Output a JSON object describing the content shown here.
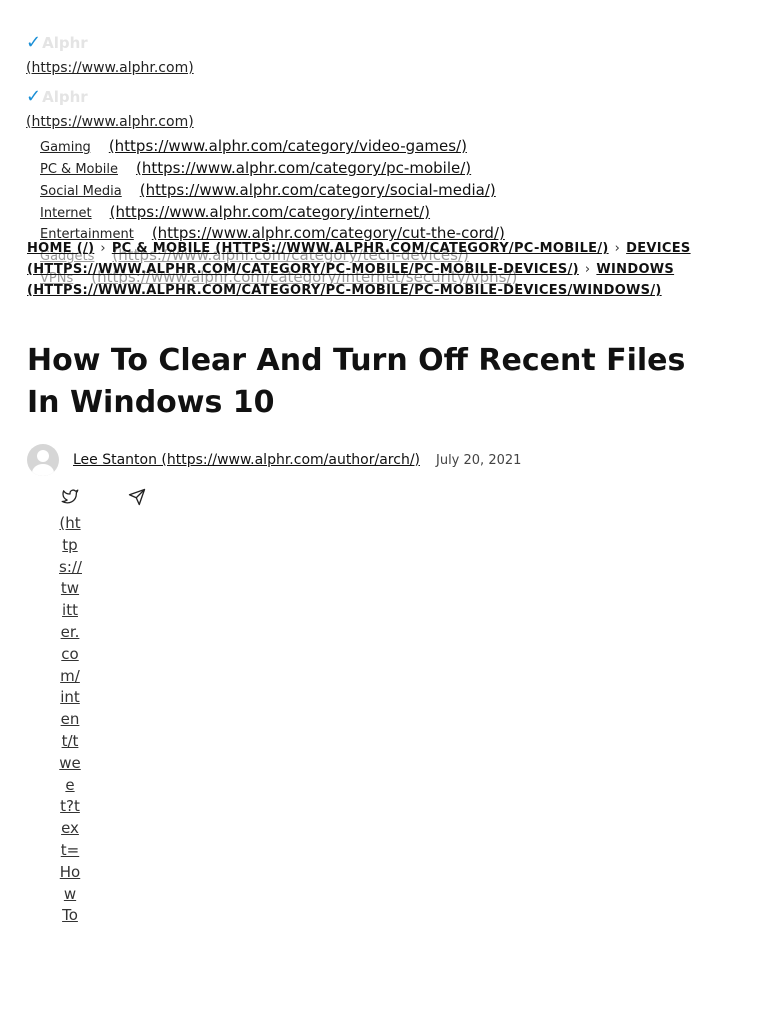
{
  "site": {
    "logo_text": "Alphr",
    "logo_url_text": "(https://www.alphr.com)"
  },
  "nav": [
    {
      "label": "Gaming",
      "url": "(https://www.alphr.com/category/video-games/)"
    },
    {
      "label": "PC & Mobile",
      "url": "(https://www.alphr.com/category/pc-mobile/)"
    },
    {
      "label": "Social Media",
      "url": "(https://www.alphr.com/category/social-media/)"
    },
    {
      "label": "Internet",
      "url": "(https://www.alphr.com/category/internet/)"
    },
    {
      "label": "Entertainment",
      "url": "(https://www.alphr.com/category/cut-the-cord/)"
    },
    {
      "label": "Gadgets",
      "url": "(https://www.alphr.com/category/tech-devices/)"
    },
    {
      "label": "VPNs",
      "url": "(https://www.alphr.com/category/internet/security/vpns/)"
    }
  ],
  "breadcrumb": {
    "home": "Home (/)",
    "pc_mobile": "PC & Mobile (https://www.alphr.com/category/pc-mobile/)",
    "devices": "Devices (https://www.alphr.com/category/pc-mobile/pc-mobile-devices/)",
    "windows": "Windows (https://www.alphr.com/category/pc-mobile/pc-mobile-devices/windows/)"
  },
  "article": {
    "title": "How To Clear And Turn Off Recent Files In Windows 10",
    "author": "Lee Stanton (https://www.alphr.com/author/arch/)",
    "date": "July 20, 2021"
  },
  "share": {
    "tweet_link_text": "(https://twitter.com/intent/tweet?text=How To",
    "icons": [
      "twitter-icon",
      "send-icon"
    ]
  },
  "colors": {
    "accent": "#1a8fd6",
    "text": "#111111",
    "faded_logo": "#e4e4e4"
  }
}
